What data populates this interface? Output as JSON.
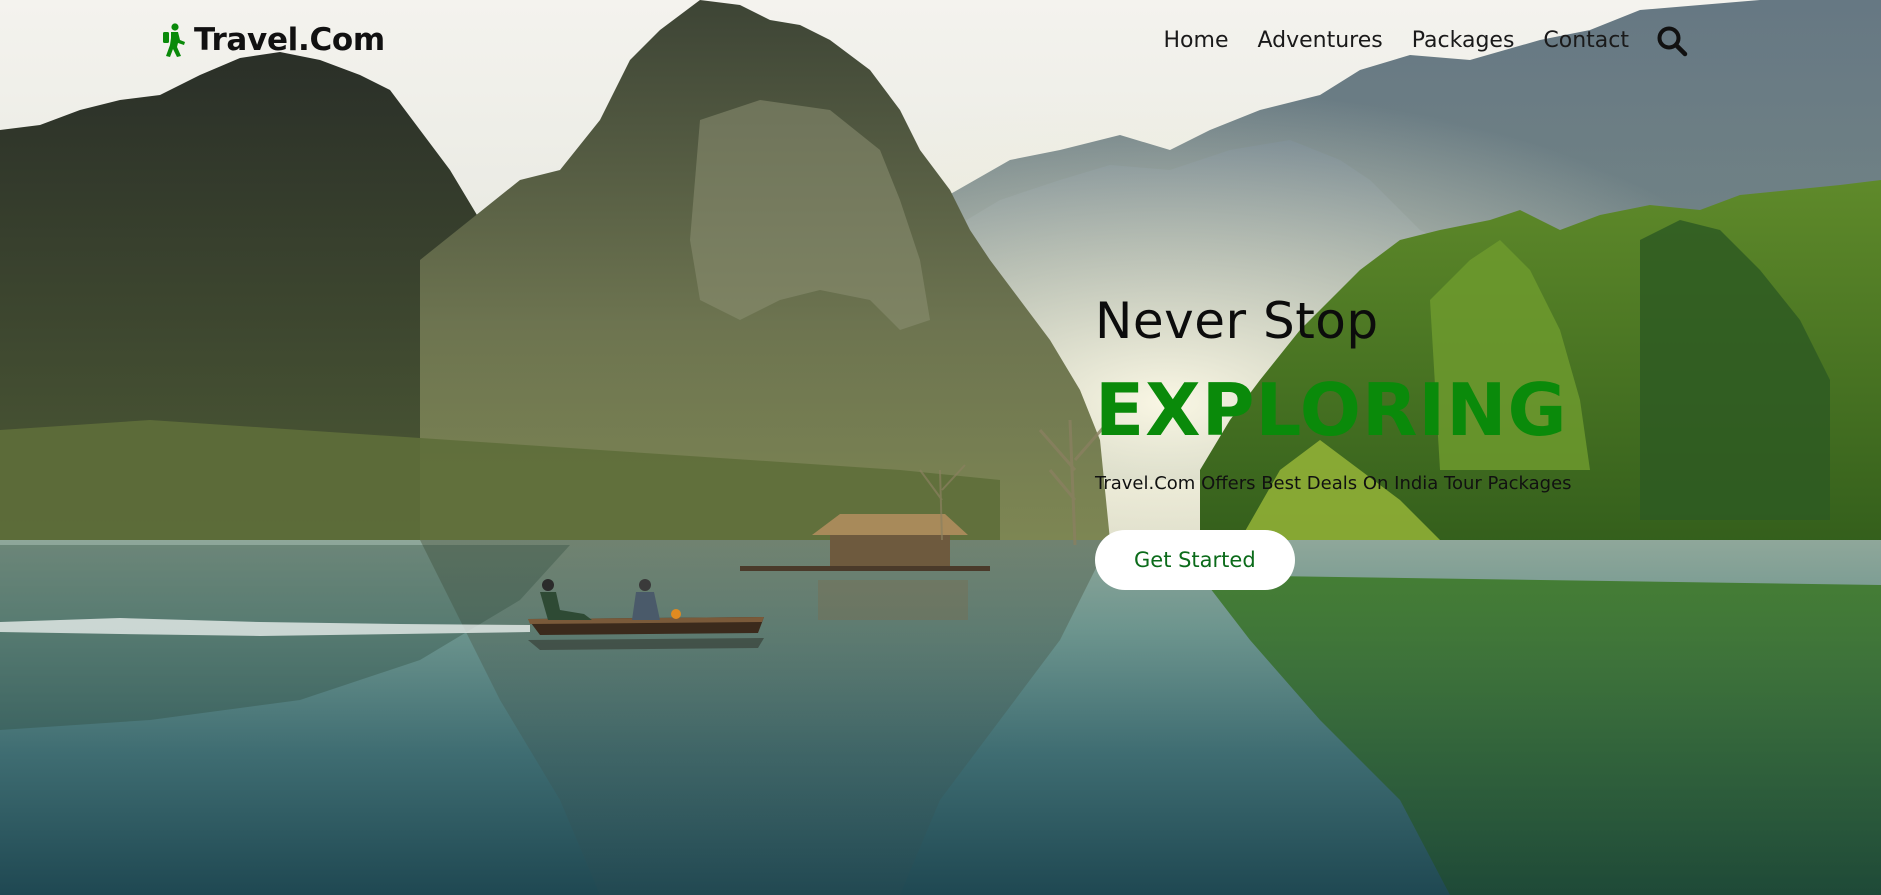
{
  "brand": {
    "name": "Travel.Com",
    "icon": "hiker-icon",
    "icon_color": "#0a8a0a"
  },
  "nav": {
    "items": [
      {
        "label": "Home"
      },
      {
        "label": "Adventures"
      },
      {
        "label": "Packages"
      },
      {
        "label": "Contact"
      }
    ],
    "search_icon": "search-icon"
  },
  "hero": {
    "line1": "Never Stop",
    "line2": "EXPLORING",
    "subtitle": "Travel.Com Offers Best Deals On India Tour Packages",
    "cta_label": "Get Started",
    "accent_color": "#0a8a0a"
  }
}
